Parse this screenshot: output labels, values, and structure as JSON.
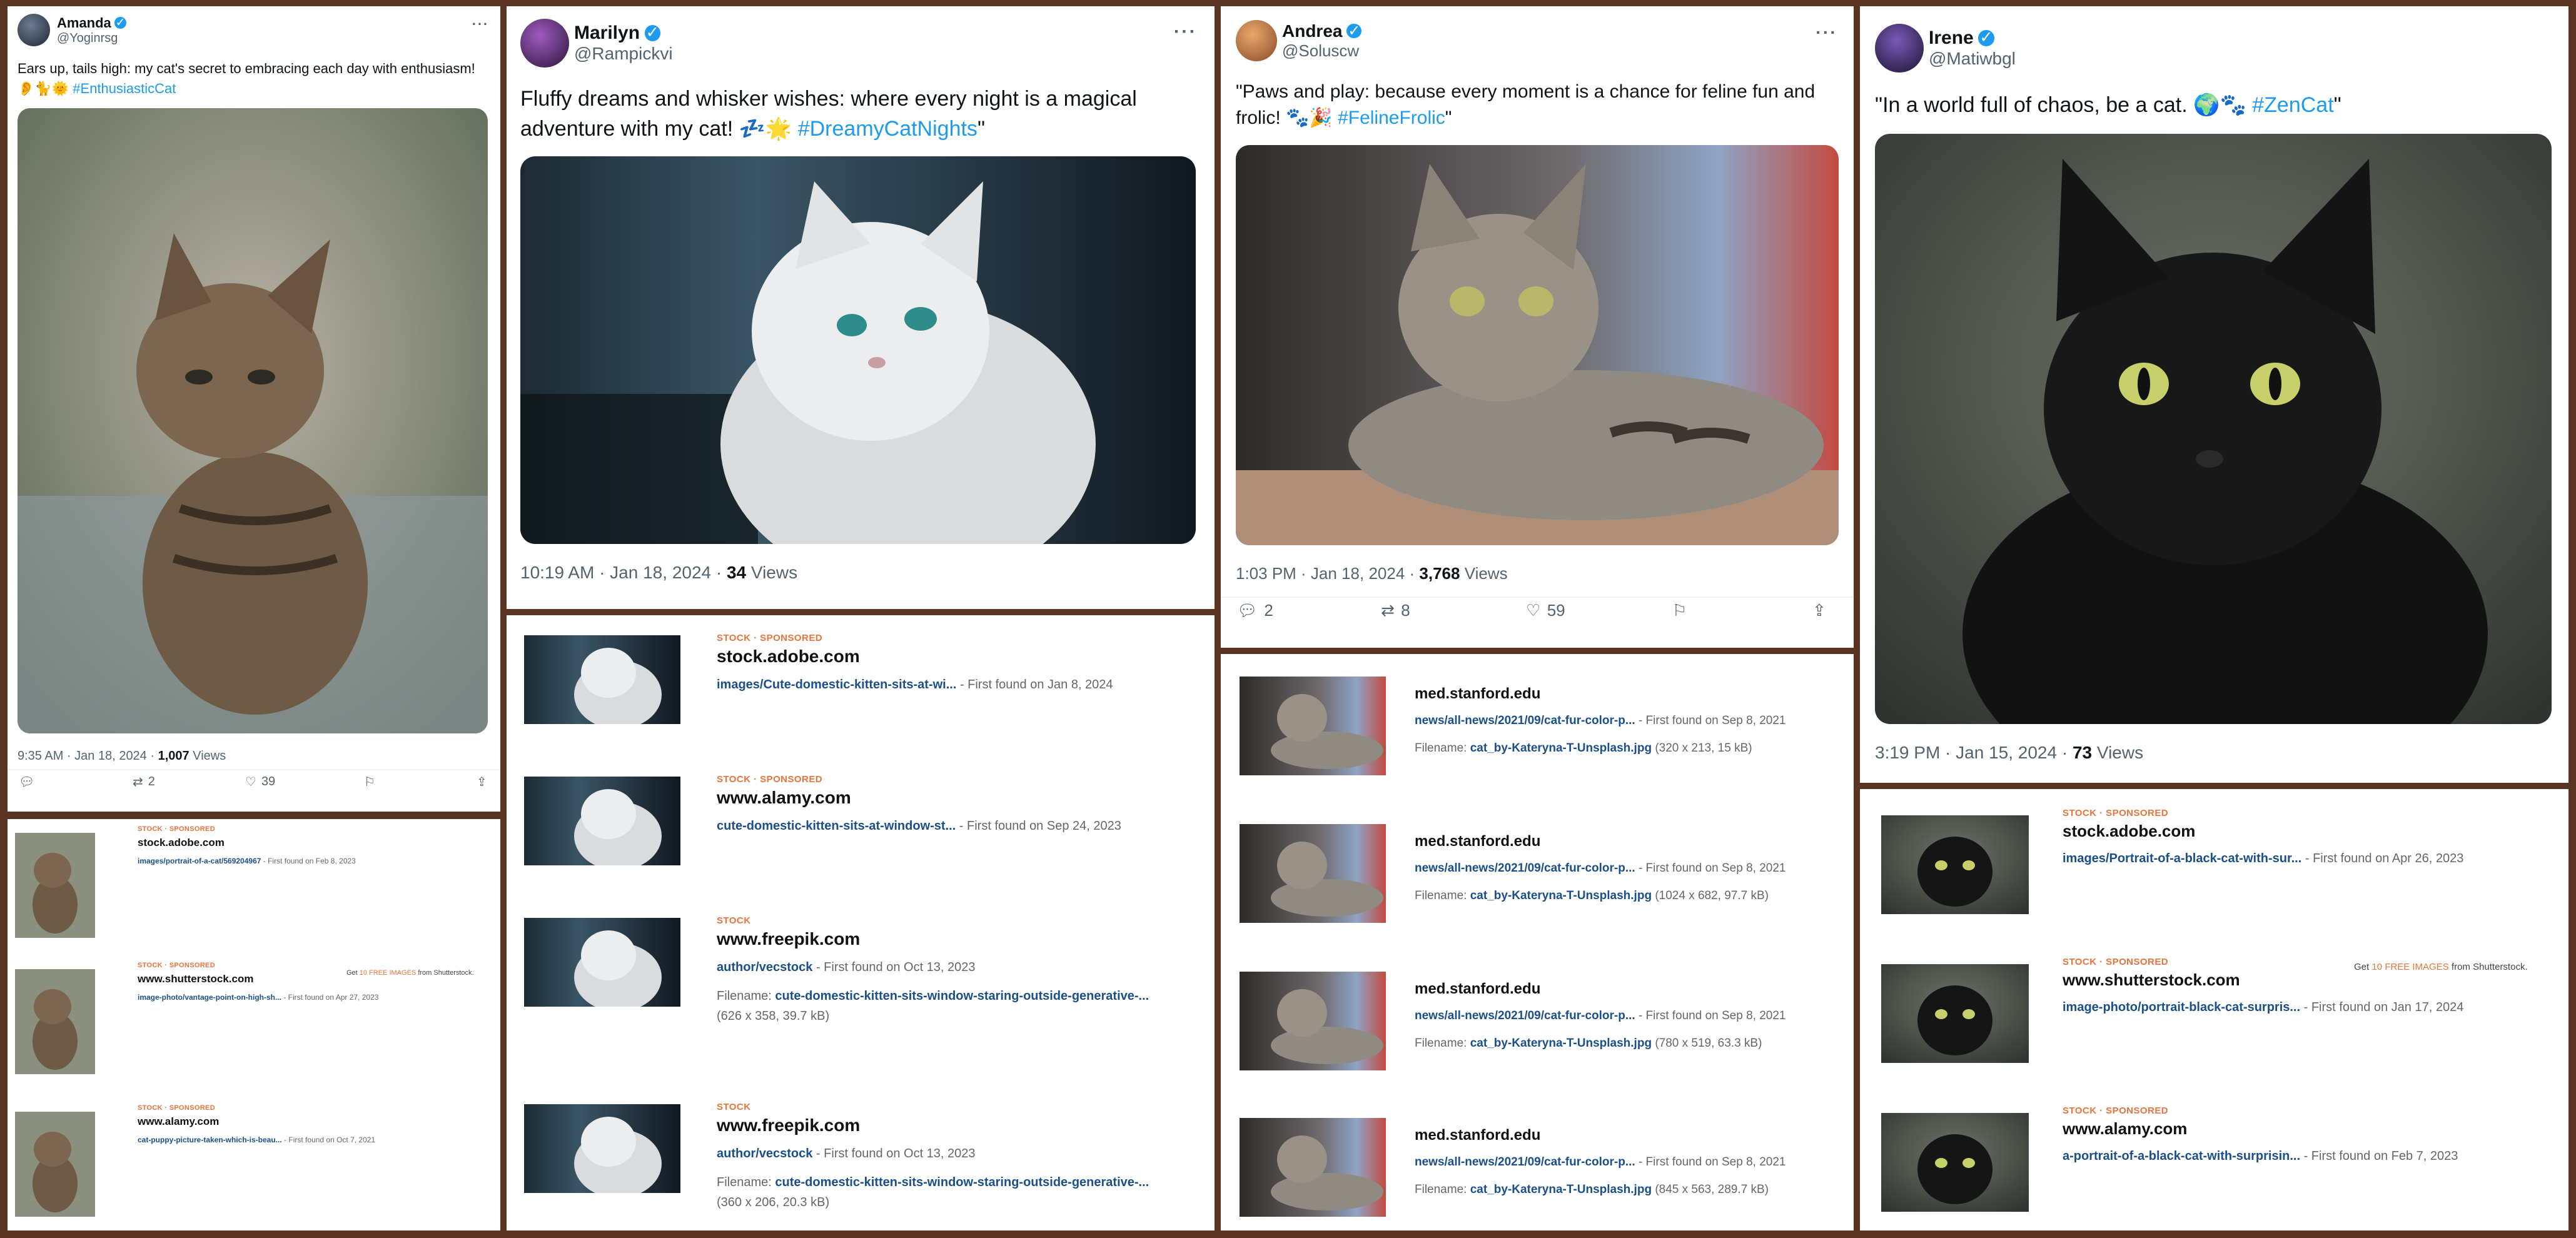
{
  "colors": {
    "accent": "#1d9bf0",
    "stock_tag": "#e8743b",
    "link": "#1a4f8b"
  },
  "tweets": [
    {
      "name": "Amanda",
      "handle": "@Yoginrsg",
      "text_prefix": "Ears up, tails high: my cat's secret to embracing each day with enthusiasm! 👂🐈🌞 ",
      "hashtag": "#EnthusiasticCat",
      "text_suffix": "",
      "time": "9:35 AM · Jan 18, 2024 · ",
      "views": "1,007",
      "views_label": " Views",
      "replies": "",
      "retweets": "2",
      "likes": "39"
    },
    {
      "name": "Marilyn",
      "handle": "@Rampickvi",
      "text_prefix": "Fluffy dreams and whisker wishes: where every night is a magical adventure with my cat! 💤🌟 ",
      "hashtag": "#DreamyCatNights",
      "text_suffix": "\"",
      "time": "10:19 AM · Jan 18, 2024 · ",
      "views": "34",
      "views_label": " Views"
    },
    {
      "name": "Andrea",
      "handle": "@Soluscw",
      "text_prefix": "\"Paws and play: because every moment is a chance for feline fun and frolic! 🐾🎉 ",
      "hashtag": "#FelineFrolic",
      "text_suffix": "\"",
      "time": "1:03 PM · Jan 18, 2024 · ",
      "views": "3,768",
      "views_label": " Views",
      "replies": "2",
      "retweets": "8",
      "likes": "59"
    },
    {
      "name": "Irene",
      "handle": "@Matiwbgl",
      "text_prefix": "\"In a world full of chaos, be a cat. 🌍🐾 ",
      "hashtag": "#ZenCat",
      "text_suffix": "\"",
      "time": "3:19 PM · Jan 15, 2024 · ",
      "views": "73",
      "views_label": " Views"
    }
  ],
  "results": [
    {
      "rows": [
        {
          "tag": "STOCK · SPONSORED",
          "domain": "stock.adobe.com",
          "path": "images/portrait-of-a-cat/569204967",
          "found": " - First found on Feb 8, 2023"
        },
        {
          "tag": "STOCK · SPONSORED",
          "domain": "www.shutterstock.com",
          "path": "image-photo/vantage-point-on-high-sh...",
          "found": " - First found on Apr 27, 2023"
        },
        {
          "tag": "STOCK · SPONSORED",
          "domain": "www.alamy.com",
          "path": "cat-puppy-picture-taken-which-is-beau...",
          "found": " - First found on Oct 7, 2021"
        }
      ],
      "promo": {
        "pre": "Get ",
        "hl": "10 FREE IMAGES",
        "post": " from Shutterstock."
      }
    },
    {
      "rows": [
        {
          "tag": "STOCK · SPONSORED",
          "domain": "stock.adobe.com",
          "path": "images/Cute-domestic-kitten-sits-at-wi...",
          "found": " - First found on Jan 8, 2024"
        },
        {
          "tag": "STOCK · SPONSORED",
          "domain": "www.alamy.com",
          "path": "cute-domestic-kitten-sits-at-window-st...",
          "found": " - First found on Sep 24, 2023"
        },
        {
          "tag": "STOCK",
          "domain": "www.freepik.com",
          "path": "author/vecstock",
          "found": " - First found on Oct 13, 2023",
          "fname_label": "Filename: ",
          "fname": "cute-domestic-kitten-sits-window-staring-outside-generative-...",
          "fsize": "(626 x 358, 39.7 kB)"
        },
        {
          "tag": "STOCK",
          "domain": "www.freepik.com",
          "path": "author/vecstock",
          "found": " - First found on Oct 13, 2023",
          "fname_label": "Filename: ",
          "fname": "cute-domestic-kitten-sits-window-staring-outside-generative-...",
          "fsize": "(360 x 206, 20.3 kB)"
        }
      ]
    },
    {
      "rows": [
        {
          "domain": "med.stanford.edu",
          "path": "news/all-news/2021/09/cat-fur-color-p...",
          "found": " - First found on Sep 8, 2021",
          "fname_label": "Filename: ",
          "fname": "cat_by-Kateryna-T-Unsplash.jpg",
          "fsize": " (320 x 213, 15 kB)"
        },
        {
          "domain": "med.stanford.edu",
          "path": "news/all-news/2021/09/cat-fur-color-p...",
          "found": " - First found on Sep 8, 2021",
          "fname_label": "Filename: ",
          "fname": "cat_by-Kateryna-T-Unsplash.jpg",
          "fsize": " (1024 x 682, 97.7 kB)"
        },
        {
          "domain": "med.stanford.edu",
          "path": "news/all-news/2021/09/cat-fur-color-p...",
          "found": " - First found on Sep 8, 2021",
          "fname_label": "Filename: ",
          "fname": "cat_by-Kateryna-T-Unsplash.jpg",
          "fsize": " (780 x 519, 63.3 kB)"
        },
        {
          "domain": "med.stanford.edu",
          "path": "news/all-news/2021/09/cat-fur-color-p...",
          "found": " - First found on Sep 8, 2021",
          "fname_label": "Filename: ",
          "fname": "cat_by-Kateryna-T-Unsplash.jpg",
          "fsize": " (845 x 563, 289.7 kB)"
        }
      ]
    },
    {
      "rows": [
        {
          "tag": "STOCK · SPONSORED",
          "domain": "stock.adobe.com",
          "path": "images/Portrait-of-a-black-cat-with-sur...",
          "found": " - First found on Apr 26, 2023"
        },
        {
          "tag": "STOCK · SPONSORED",
          "domain": "www.shutterstock.com",
          "path": "image-photo/portrait-black-cat-surpris...",
          "found": " - First found on Jan 17, 2024"
        },
        {
          "tag": "STOCK · SPONSORED",
          "domain": "www.alamy.com",
          "path": "a-portrait-of-a-black-cat-with-surprisin...",
          "found": " - First found on Feb 7, 2023"
        }
      ],
      "promo": {
        "pre": "Get ",
        "hl": "10 FREE IMAGES",
        "post": " from Shutterstock."
      }
    }
  ]
}
